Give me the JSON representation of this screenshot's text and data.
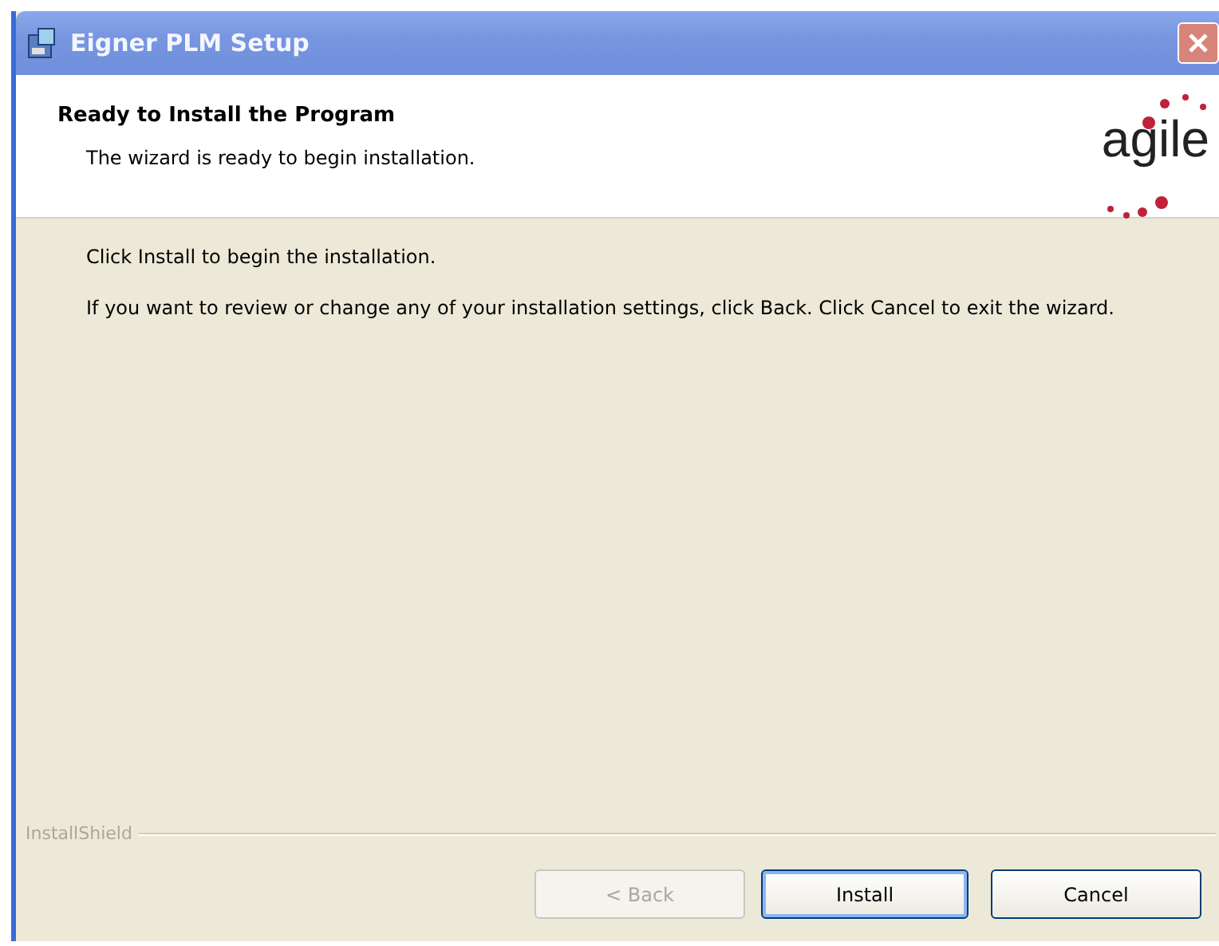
{
  "window": {
    "title": "Eigner PLM Setup"
  },
  "header": {
    "title": "Ready to Install the Program",
    "subtitle": "The wizard is ready to begin installation.",
    "logo": "agile"
  },
  "body": {
    "paragraphs": [
      "Click Install to begin the installation.",
      "If you want to review or change any of your installation settings, click Back. Click Cancel to exit the wizard."
    ]
  },
  "footer": {
    "brand": "InstallShield"
  },
  "buttons": [
    {
      "label": "< Back",
      "disabled": true,
      "default": false
    },
    {
      "label": "Install",
      "disabled": false,
      "default": true
    },
    {
      "label": "Cancel",
      "disabled": false,
      "default": false
    }
  ]
}
